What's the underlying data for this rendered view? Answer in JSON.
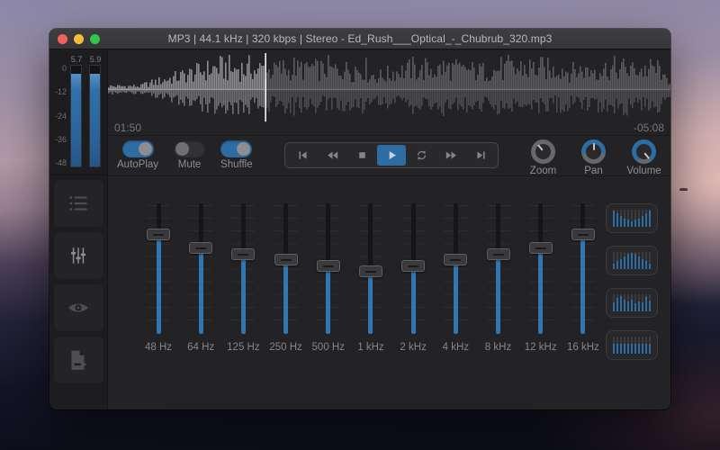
{
  "window": {
    "title": "MP3 | 44.1 kHz | 320 kbps | Stereo - Ed_Rush___Optical_-_Chubrub_320.mp3",
    "traffic_lights": [
      {
        "id": "close",
        "color": "#f4605a"
      },
      {
        "id": "minimize",
        "color": "#f6bd3a"
      },
      {
        "id": "zoom",
        "color": "#33c748"
      }
    ]
  },
  "meter": {
    "peak_labels": [
      "5.7",
      "5.9"
    ],
    "scale_labels": [
      "0",
      "-12",
      "-24",
      "-36",
      "-48"
    ],
    "channels": [
      {
        "name": "left",
        "level_percent": 92
      },
      {
        "name": "right",
        "level_percent": 92
      }
    ]
  },
  "waveform": {
    "elapsed": "01:50",
    "remaining": "-05:08",
    "progress_percent": 28
  },
  "toggles": [
    {
      "id": "autoplay",
      "label": "AutoPlay",
      "on": true
    },
    {
      "id": "mute",
      "label": "Mute",
      "on": false
    },
    {
      "id": "shuffle",
      "label": "Shuffle",
      "on": true
    }
  ],
  "transport": [
    {
      "id": "skip-back",
      "active": false
    },
    {
      "id": "rewind",
      "active": false
    },
    {
      "id": "stop",
      "active": false
    },
    {
      "id": "play",
      "active": true
    },
    {
      "id": "repeat",
      "active": false
    },
    {
      "id": "fast-forward",
      "active": false
    },
    {
      "id": "skip-forward",
      "active": false
    }
  ],
  "knobs": [
    {
      "id": "zoom",
      "label": "Zoom",
      "indicator_deg": -40,
      "ring": "gray"
    },
    {
      "id": "pan",
      "label": "Pan",
      "indicator_deg": 0,
      "ring": "pan"
    },
    {
      "id": "volume",
      "label": "Volume",
      "indicator_deg": 140,
      "ring": "volume"
    }
  ],
  "sidebar": [
    {
      "id": "playlist",
      "active": false
    },
    {
      "id": "equalizer",
      "active": true
    },
    {
      "id": "visualizer",
      "active": false
    },
    {
      "id": "export",
      "active": false
    }
  ],
  "equalizer": {
    "bands": [
      {
        "label": "48 Hz",
        "thumb_percent_from_top": 24
      },
      {
        "label": "64 Hz",
        "thumb_percent_from_top": 34
      },
      {
        "label": "125 Hz",
        "thumb_percent_from_top": 39
      },
      {
        "label": "250 Hz",
        "thumb_percent_from_top": 43
      },
      {
        "label": "500 Hz",
        "thumb_percent_from_top": 48
      },
      {
        "label": "1 kHz",
        "thumb_percent_from_top": 52
      },
      {
        "label": "2 kHz",
        "thumb_percent_from_top": 48
      },
      {
        "label": "4 kHz",
        "thumb_percent_from_top": 43
      },
      {
        "label": "8 kHz",
        "thumb_percent_from_top": 39
      },
      {
        "label": "12 kHz",
        "thumb_percent_from_top": 34
      },
      {
        "label": "16 kHz",
        "thumb_percent_from_top": 24
      }
    ],
    "presets": [
      {
        "id": "v-shape",
        "bars": [
          95,
          78,
          62,
          50,
          40,
          34,
          40,
          50,
          62,
          78,
          95
        ]
      },
      {
        "id": "arch",
        "bars": [
          34,
          46,
          60,
          74,
          88,
          95,
          88,
          74,
          60,
          46,
          34
        ]
      },
      {
        "id": "custom-wave",
        "bars": [
          55,
          80,
          92,
          68,
          56,
          70,
          48,
          58,
          52,
          82,
          64
        ]
      },
      {
        "id": "flat",
        "bars": [
          60,
          60,
          60,
          60,
          60,
          60,
          60,
          60,
          60,
          60,
          60
        ]
      }
    ]
  },
  "colors": {
    "accent_blue": "#2e6da4",
    "slider_blue": "#3077b2",
    "knob_gray": "#67686c"
  }
}
